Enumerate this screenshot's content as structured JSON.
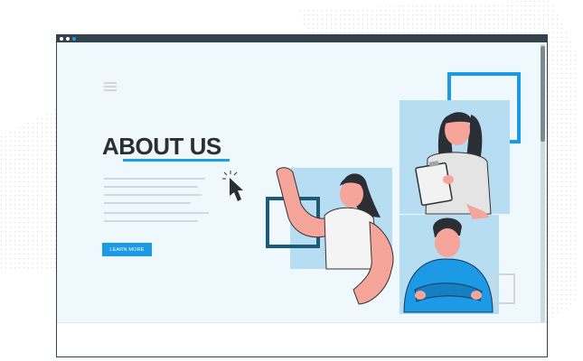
{
  "page": {
    "heading": "ABOUT US",
    "cta_label": "LEARN MORE"
  },
  "colors": {
    "accent": "#1c9ae6",
    "panel": "#b6ddf2",
    "dark": "#34424c"
  },
  "icons": [
    "hamburger-icon",
    "cursor-icon"
  ]
}
